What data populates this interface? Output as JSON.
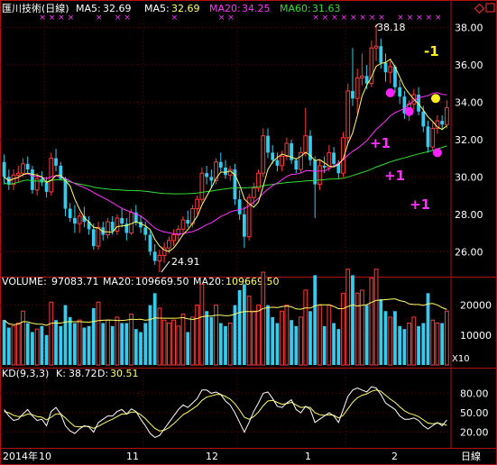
{
  "colors": {
    "background": "#000000",
    "frame": "#b01010",
    "up": "#ff3b3b",
    "down": "#33ccee",
    "ma5": "#ffff66",
    "ma20": "#ff33ff",
    "ma60": "#33dd33",
    "label": "#ffffff",
    "vol_ma": "#ffff66",
    "kd_k": "#ffffff",
    "kd_d": "#ffff66",
    "marker_magenta": "#ff22ff",
    "marker_yellow": "#ffee22"
  },
  "header": {
    "title": "匯川技術(日線)",
    "ma5_label": "MA5:",
    "ma5_value": "32.69",
    "ma5b_label": "MA5:",
    "ma5b_value": "32.69",
    "ma20_label": "MA20:",
    "ma20_value": "34.25",
    "ma60_label": "MA60:",
    "ma60_value": "31.63"
  },
  "volume_header": {
    "label": "VOLUME:",
    "value": "97083.71",
    "ma20_label": "MA20:",
    "ma20_value": "109669.50",
    "ma20b_label": "MA20:",
    "ma20b_value": "109669.50"
  },
  "kd_header": {
    "label": "KD(9,3,3)",
    "k_label": "K:",
    "k_value": "38.72",
    "d_label": "D:",
    "d_value": "30.51"
  },
  "footer": {
    "year": "2014年",
    "months": [
      "10",
      "11",
      "12",
      "1",
      "2"
    ],
    "period": "日線"
  },
  "annotations": {
    "high": "38.18",
    "low": "24.91",
    "minus_one": "-1",
    "plus_ones": [
      "+1",
      "+1",
      "+1"
    ],
    "vol_multiplier": "X10"
  },
  "chart_data": {
    "type": "candlestick",
    "title": "匯川技術(日線)",
    "price_axis": {
      "ylim": [
        25.0,
        38.6
      ],
      "ticks": [
        "26.00",
        "28.00",
        "30.00",
        "32.00",
        "34.00",
        "36.00",
        "38.00"
      ]
    },
    "volume_axis": {
      "ylim": [
        0,
        25000
      ],
      "ticks": [
        "10000",
        "20000"
      ]
    },
    "kd_axis": {
      "ylim": [
        0,
        100
      ],
      "ticks": [
        "20.00",
        "50.00",
        "80.00"
      ]
    },
    "ohlc": [
      [
        30.8,
        31.2,
        29.6,
        30.0
      ],
      [
        30.0,
        30.4,
        29.3,
        29.6
      ],
      [
        29.6,
        30.4,
        29.3,
        30.1
      ],
      [
        30.1,
        30.6,
        29.7,
        30.2
      ],
      [
        30.2,
        31.0,
        30.0,
        30.7
      ],
      [
        30.7,
        31.1,
        30.2,
        30.4
      ],
      [
        30.4,
        30.6,
        29.1,
        29.3
      ],
      [
        29.3,
        30.2,
        29.0,
        29.9
      ],
      [
        29.9,
        30.3,
        29.5,
        29.7
      ],
      [
        29.7,
        30.0,
        28.9,
        29.2
      ],
      [
        29.2,
        31.3,
        29.0,
        31.0
      ],
      [
        31.0,
        31.5,
        30.3,
        30.6
      ],
      [
        30.6,
        30.8,
        29.8,
        29.9
      ],
      [
        29.9,
        30.0,
        27.9,
        28.3
      ],
      [
        28.3,
        28.6,
        27.6,
        27.8
      ],
      [
        27.8,
        28.5,
        27.0,
        27.5
      ],
      [
        27.5,
        28.1,
        27.0,
        27.9
      ],
      [
        27.9,
        28.4,
        27.3,
        27.6
      ],
      [
        27.6,
        27.9,
        26.9,
        27.2
      ],
      [
        27.2,
        27.5,
        26.1,
        26.3
      ],
      [
        26.3,
        27.6,
        26.1,
        27.3
      ],
      [
        27.3,
        27.6,
        26.6,
        26.9
      ],
      [
        26.9,
        27.8,
        26.7,
        27.6
      ],
      [
        27.6,
        27.9,
        26.9,
        27.1
      ],
      [
        27.1,
        28.0,
        26.9,
        27.8
      ],
      [
        27.8,
        28.3,
        27.3,
        27.5
      ],
      [
        27.5,
        27.8,
        26.6,
        27.0
      ],
      [
        27.0,
        28.3,
        26.9,
        28.1
      ],
      [
        28.1,
        28.5,
        27.4,
        27.6
      ],
      [
        27.6,
        27.9,
        27.0,
        27.3
      ],
      [
        27.3,
        27.6,
        26.6,
        26.9
      ],
      [
        26.9,
        27.1,
        25.8,
        26.0
      ],
      [
        26.0,
        26.4,
        25.3,
        25.5
      ],
      [
        25.5,
        26.1,
        24.9,
        25.8
      ],
      [
        25.8,
        26.5,
        25.4,
        26.2
      ],
      [
        26.2,
        26.8,
        25.9,
        26.6
      ],
      [
        26.6,
        27.2,
        26.3,
        26.9
      ],
      [
        26.9,
        27.4,
        26.5,
        27.2
      ],
      [
        27.2,
        27.9,
        27.0,
        27.7
      ],
      [
        27.7,
        28.2,
        27.3,
        27.5
      ],
      [
        27.5,
        28.5,
        27.3,
        28.3
      ],
      [
        28.3,
        29.0,
        28.0,
        28.8
      ],
      [
        28.8,
        30.5,
        28.6,
        30.2
      ],
      [
        30.2,
        30.6,
        29.6,
        30.0
      ],
      [
        30.0,
        30.4,
        29.4,
        29.8
      ],
      [
        29.8,
        31.0,
        29.6,
        30.8
      ],
      [
        30.8,
        31.3,
        30.3,
        30.5
      ],
      [
        30.5,
        30.9,
        29.9,
        30.1
      ],
      [
        30.1,
        30.6,
        29.8,
        30.4
      ],
      [
        30.4,
        30.7,
        28.5,
        28.8
      ],
      [
        28.8,
        29.3,
        27.7,
        28.0
      ],
      [
        28.0,
        28.4,
        26.2,
        26.8
      ],
      [
        26.8,
        29.1,
        26.6,
        28.9
      ],
      [
        28.9,
        29.7,
        28.5,
        29.4
      ],
      [
        29.4,
        30.4,
        29.2,
        30.2
      ],
      [
        30.2,
        32.6,
        30.0,
        32.2
      ],
      [
        32.2,
        32.6,
        31.0,
        31.3
      ],
      [
        31.3,
        31.7,
        30.7,
        30.9
      ],
      [
        30.9,
        31.3,
        30.3,
        30.6
      ],
      [
        30.6,
        31.4,
        30.3,
        31.1
      ],
      [
        31.1,
        32.1,
        30.9,
        31.8
      ],
      [
        31.8,
        32.0,
        30.7,
        30.9
      ],
      [
        30.9,
        31.0,
        30.2,
        30.4
      ],
      [
        30.4,
        31.6,
        30.2,
        31.3
      ],
      [
        31.3,
        33.7,
        31.1,
        32.2
      ],
      [
        32.2,
        32.5,
        30.6,
        30.9
      ],
      [
        30.9,
        31.1,
        27.8,
        29.6
      ],
      [
        29.6,
        30.9,
        29.3,
        30.6
      ],
      [
        30.6,
        31.1,
        30.2,
        30.5
      ],
      [
        30.5,
        31.7,
        30.3,
        31.3
      ],
      [
        31.3,
        31.6,
        30.5,
        30.7
      ],
      [
        30.7,
        30.9,
        29.9,
        30.2
      ],
      [
        30.2,
        32.4,
        30.0,
        32.1
      ],
      [
        32.1,
        35.0,
        31.8,
        34.6
      ],
      [
        34.6,
        36.9,
        33.8,
        34.2
      ],
      [
        34.2,
        35.8,
        33.4,
        35.3
      ],
      [
        35.3,
        36.6,
        34.9,
        35.4
      ],
      [
        35.4,
        36.0,
        34.7,
        35.0
      ],
      [
        35.0,
        37.3,
        34.8,
        36.9
      ],
      [
        36.9,
        38.18,
        36.2,
        37.0
      ],
      [
        37.0,
        37.4,
        35.8,
        36.1
      ],
      [
        36.1,
        36.6,
        35.1,
        35.6
      ],
      [
        35.6,
        36.2,
        35.0,
        35.9
      ],
      [
        35.9,
        36.0,
        34.5,
        34.8
      ],
      [
        34.8,
        35.2,
        33.9,
        34.3
      ],
      [
        34.3,
        34.6,
        33.1,
        33.4
      ],
      [
        33.4,
        34.1,
        33.0,
        33.9
      ],
      [
        33.9,
        34.7,
        33.6,
        34.4
      ],
      [
        34.4,
        34.8,
        33.3,
        33.5
      ],
      [
        33.5,
        33.8,
        32.4,
        32.7
      ],
      [
        32.7,
        33.0,
        31.3,
        31.6
      ],
      [
        31.6,
        32.9,
        31.4,
        32.6
      ],
      [
        32.6,
        33.3,
        32.3,
        33.0
      ],
      [
        33.0,
        33.3,
        32.5,
        32.8
      ],
      [
        32.8,
        34.1,
        32.6,
        33.7
      ]
    ],
    "volume": [
      150,
      125,
      130,
      140,
      180,
      140,
      110,
      120,
      130,
      100,
      210,
      150,
      130,
      200,
      160,
      140,
      150,
      125,
      130,
      190,
      210,
      140,
      150,
      130,
      160,
      140,
      140,
      170,
      120,
      110,
      140,
      200,
      240,
      190,
      150,
      140,
      150,
      130,
      170,
      110,
      160,
      200,
      270,
      180,
      160,
      200,
      140,
      130,
      140,
      200,
      250,
      270,
      230,
      180,
      200,
      310,
      200,
      160,
      140,
      180,
      200,
      150,
      130,
      160,
      250,
      180,
      300,
      200,
      130,
      200,
      140,
      120,
      240,
      320,
      300,
      240,
      250,
      200,
      290,
      320,
      220,
      180,
      160,
      180,
      130,
      120,
      140,
      160,
      130,
      140,
      240,
      150,
      140,
      140,
      180
    ],
    "kd_k": [
      55,
      45,
      38,
      40,
      48,
      55,
      45,
      38,
      40,
      30,
      52,
      58,
      48,
      30,
      22,
      18,
      25,
      30,
      28,
      20,
      35,
      40,
      45,
      45,
      52,
      55,
      48,
      56,
      52,
      40,
      30,
      18,
      12,
      15,
      25,
      35,
      45,
      55,
      62,
      58,
      65,
      72,
      85,
      85,
      80,
      82,
      78,
      68,
      62,
      50,
      35,
      20,
      35,
      52,
      65,
      80,
      82,
      72,
      60,
      58,
      65,
      70,
      55,
      50,
      60,
      55,
      35,
      40,
      45,
      50,
      45,
      35,
      55,
      75,
      85,
      88,
      85,
      82,
      90,
      88,
      78,
      65,
      60,
      55,
      45,
      40,
      40,
      42,
      38,
      30,
      25,
      30,
      35,
      30,
      38.72
    ],
    "kd_d": [
      52,
      50,
      46,
      44,
      45,
      48,
      47,
      44,
      43,
      39,
      43,
      48,
      48,
      42,
      35,
      29,
      28,
      29,
      29,
      26,
      29,
      33,
      37,
      40,
      44,
      48,
      48,
      51,
      51,
      47,
      41,
      33,
      26,
      22,
      23,
      27,
      33,
      40,
      47,
      51,
      56,
      61,
      69,
      74,
      76,
      78,
      78,
      75,
      71,
      64,
      54,
      43,
      40,
      44,
      51,
      61,
      68,
      69,
      66,
      63,
      64,
      66,
      62,
      58,
      59,
      58,
      50,
      47,
      46,
      47,
      46,
      42,
      46,
      56,
      66,
      73,
      77,
      79,
      83,
      85,
      83,
      77,
      71,
      66,
      59,
      53,
      49,
      47,
      44,
      39,
      34,
      33,
      34,
      33,
      30.51
    ]
  }
}
